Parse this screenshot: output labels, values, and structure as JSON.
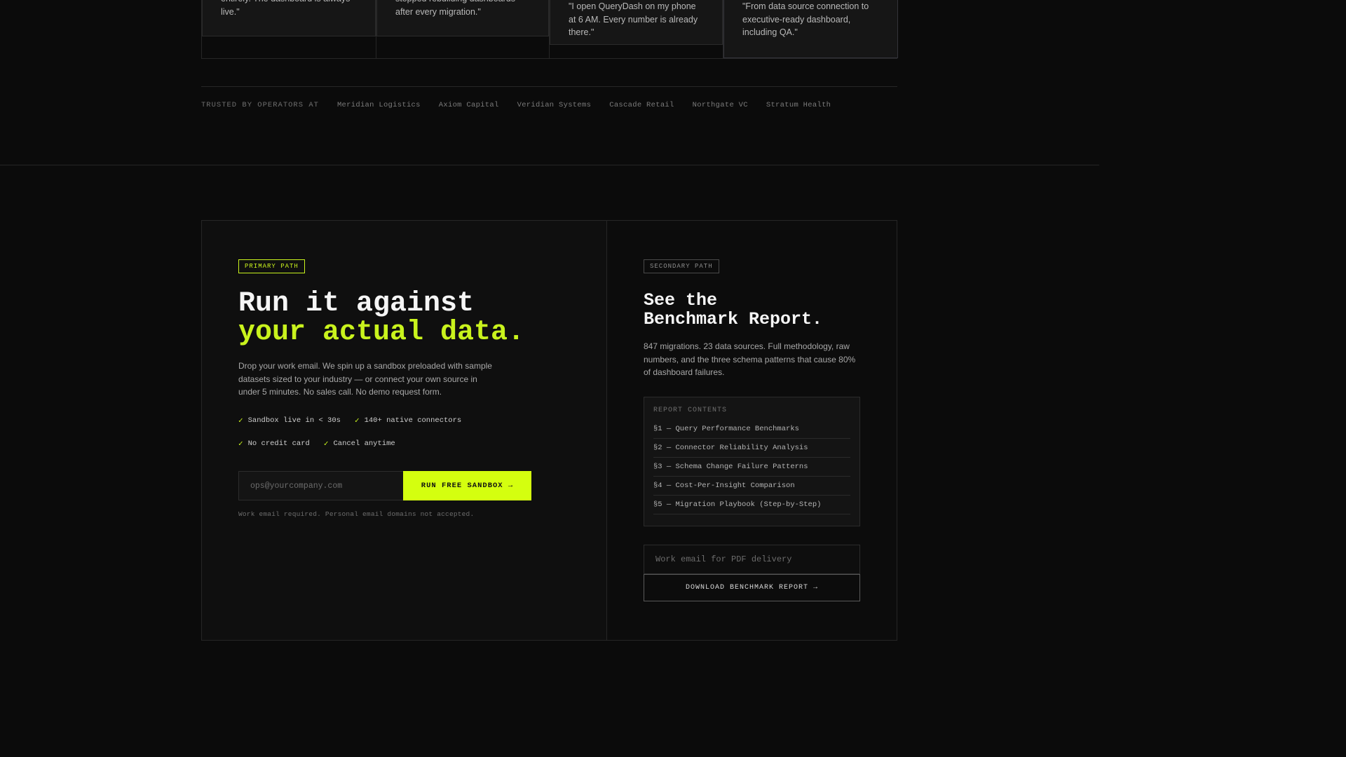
{
  "testimonials": [
    {
      "quote": "entirely. The dashboard is always live.\""
    },
    {
      "quote": "stopped rebuilding dashboards after every migration.\""
    },
    {
      "quote": "\"I open QueryDash on my phone at 6 AM. Every number is already there.\""
    },
    {
      "quote": "\"From data source connection to executive-ready dashboard, including QA.\""
    }
  ],
  "trusted": {
    "label": "TRUSTED BY OPERATORS AT",
    "companies": [
      "Meridian Logistics",
      "Axiom Capital",
      "Veridian Systems",
      "Cascade Retail",
      "Northgate VC",
      "Stratum Health"
    ]
  },
  "primary": {
    "tag": "PRIMARY PATH",
    "headline_line1": "Run it against",
    "headline_line2": "your actual data.",
    "description": "Drop your work email. We spin up a sandbox preloaded with sample datasets sized to your industry — or connect your own source in under 5 minutes. No sales call. No demo request form.",
    "checks": [
      "Sandbox live in < 30s",
      "140+ native connectors",
      "No credit card",
      "Cancel anytime"
    ],
    "check_glyph": "✓",
    "email_placeholder": "ops@yourcompany.com",
    "button_label": "RUN FREE SANDBOX →",
    "note": "Work email required. Personal email domains not accepted."
  },
  "secondary": {
    "tag": "SECONDARY PATH",
    "headline_line1": "See the",
    "headline_line2": "Benchmark Report.",
    "description": "847 migrations. 23 data sources. Full methodology, raw numbers, and the three schema patterns that cause 80% of dashboard failures.",
    "report_title": "REPORT CONTENTS",
    "report_items": [
      "§1 — Query Performance Benchmarks",
      "§2 — Connector Reliability Analysis",
      "§3 — Schema Change Failure Patterns",
      "§4 — Cost-Per-Insight Comparison",
      "§5 — Migration Playbook (Step-by-Step)"
    ],
    "email_placeholder": "Work email for PDF delivery",
    "button_label": "DOWNLOAD BENCHMARK REPORT →"
  },
  "colors": {
    "accent": "#d4ff0f",
    "background": "#0b0b0b"
  }
}
